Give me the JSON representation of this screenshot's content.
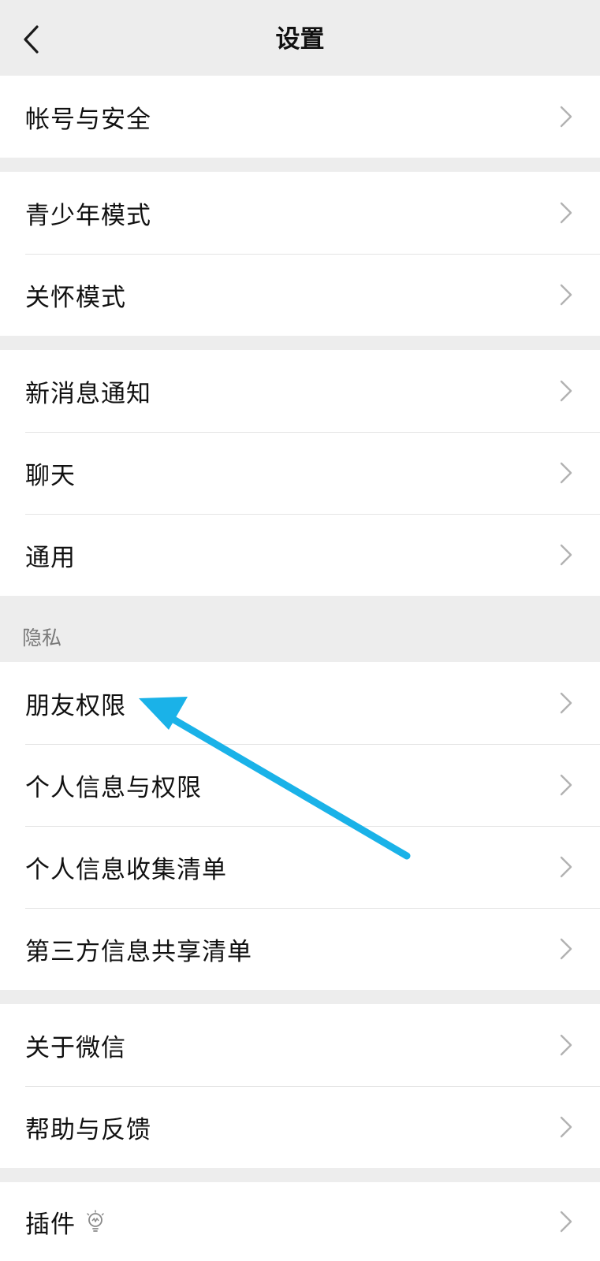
{
  "header": {
    "title": "设置",
    "back_icon": "chevron-left-icon"
  },
  "groups": [
    {
      "items": [
        {
          "label": "帐号与安全"
        }
      ]
    },
    {
      "items": [
        {
          "label": "青少年模式"
        },
        {
          "label": "关怀模式"
        }
      ]
    },
    {
      "items": [
        {
          "label": "新消息通知"
        },
        {
          "label": "聊天"
        },
        {
          "label": "通用"
        }
      ]
    },
    {
      "header": "隐私",
      "items": [
        {
          "label": "朋友权限"
        },
        {
          "label": "个人信息与权限"
        },
        {
          "label": "个人信息收集清单"
        },
        {
          "label": "第三方信息共享清单"
        }
      ]
    },
    {
      "items": [
        {
          "label": "关于微信"
        },
        {
          "label": "帮助与反馈"
        }
      ]
    },
    {
      "items": [
        {
          "label": "插件",
          "icon": "lightbulb-icon"
        }
      ]
    }
  ],
  "colors": {
    "background": "#ededed",
    "row": "#ffffff",
    "annotation_arrow": "#1ab2e8"
  }
}
